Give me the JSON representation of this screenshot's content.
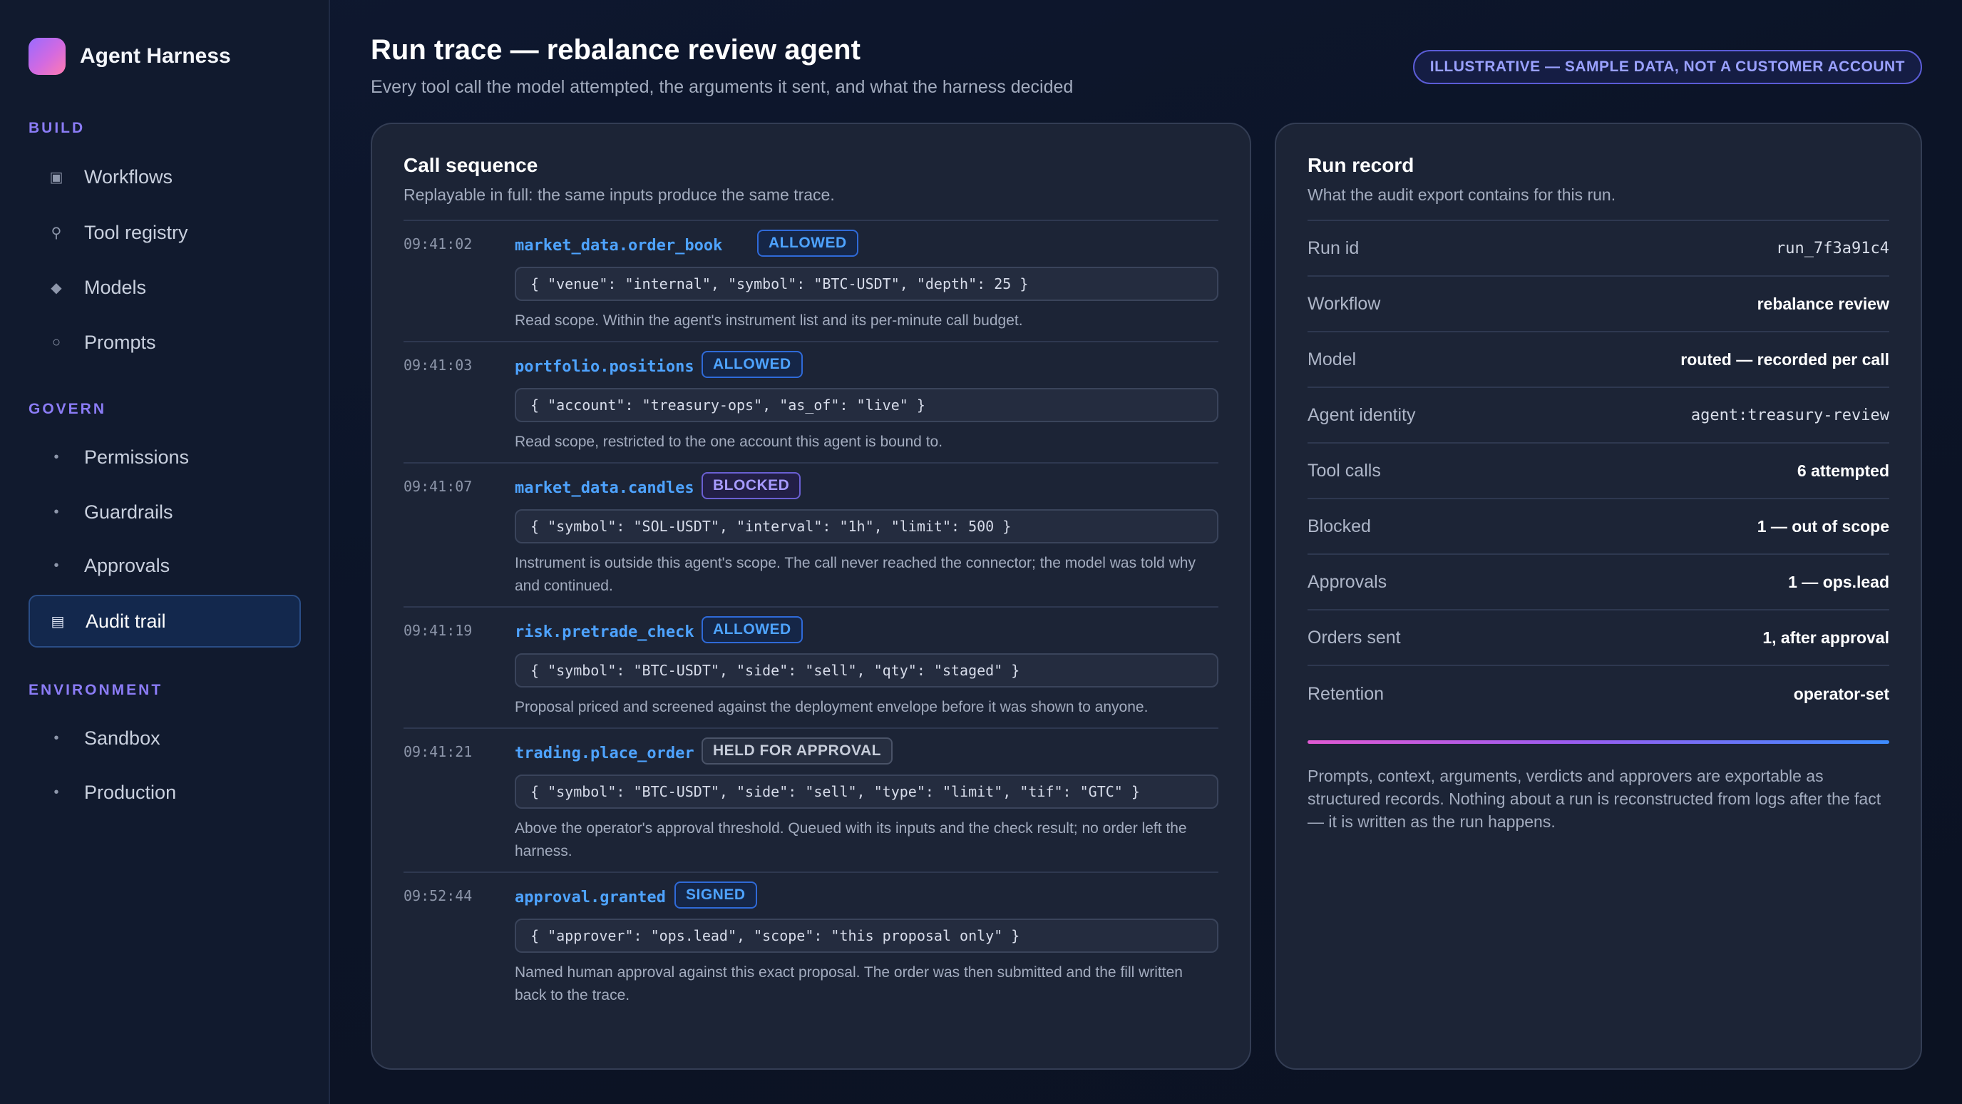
{
  "sidebar": {
    "brand": "Agent Harness",
    "sections": {
      "build": {
        "title": "BUILD",
        "items": [
          {
            "label": "Workflows",
            "icon": "square-dot-icon"
          },
          {
            "label": "Tool registry",
            "icon": "key-icon"
          },
          {
            "label": "Models",
            "icon": "diamond-icon"
          },
          {
            "label": "Prompts",
            "icon": "circle-icon"
          }
        ]
      },
      "govern": {
        "title": "GOVERN",
        "items": [
          {
            "label": "Permissions",
            "icon": "dot-icon"
          },
          {
            "label": "Guardrails",
            "icon": "dot-icon"
          },
          {
            "label": "Approvals",
            "icon": "dot-icon"
          },
          {
            "label": "Audit trail",
            "icon": "list-icon",
            "active": true
          }
        ]
      },
      "environment": {
        "title": "ENVIRONMENT",
        "items": [
          {
            "label": "Sandbox",
            "icon": "dot-icon"
          },
          {
            "label": "Production",
            "icon": "dot-icon"
          }
        ]
      }
    }
  },
  "header": {
    "title": "Run trace — rebalance review agent",
    "subtitle": "Every tool call the model attempted, the arguments it sent, and what the harness decided",
    "badge": "ILLUSTRATIVE — SAMPLE DATA, NOT A CUSTOMER ACCOUNT"
  },
  "calls_panel": {
    "title": "Call sequence",
    "subtitle": "Replayable in full: the same inputs produce the same trace.",
    "calls": [
      {
        "time": "09:41:02",
        "fn": "market_data.order_book",
        "verdict": "ALLOWED",
        "args": "{ \"venue\": \"internal\", \"symbol\": \"BTC-USDT\", \"depth\": 25 }",
        "note": "Read scope. Within the agent's instrument list and its per-minute call budget."
      },
      {
        "time": "09:41:03",
        "fn": "portfolio.positions",
        "verdict": "ALLOWED",
        "args": "{ \"account\": \"treasury-ops\", \"as_of\": \"live\" }",
        "note": "Read scope, restricted to the one account this agent is bound to."
      },
      {
        "time": "09:41:07",
        "fn": "market_data.candles",
        "verdict": "BLOCKED",
        "args": "{ \"symbol\": \"SOL-USDT\", \"interval\": \"1h\", \"limit\": 500 }",
        "note": "Instrument is outside this agent's scope. The call never reached the connector; the model was told why and continued."
      },
      {
        "time": "09:41:19",
        "fn": "risk.pretrade_check",
        "verdict": "ALLOWED",
        "args": "{ \"symbol\": \"BTC-USDT\", \"side\": \"sell\", \"qty\": \"staged\" }",
        "note": "Proposal priced and screened against the deployment envelope before it was shown to anyone."
      },
      {
        "time": "09:41:21",
        "fn": "trading.place_order",
        "verdict": "HELD FOR APPROVAL",
        "args": "{ \"symbol\": \"BTC-USDT\", \"side\": \"sell\", \"type\": \"limit\", \"tif\": \"GTC\" }",
        "note": "Above the operator's approval threshold. Queued with its inputs and the check result; no order left the harness."
      },
      {
        "time": "09:52:44",
        "fn": "approval.granted",
        "verdict": "SIGNED",
        "args": "{ \"approver\": \"ops.lead\", \"scope\": \"this proposal only\" }",
        "note": "Named human approval against this exact proposal. The order was then submitted and the fill written back to the trace."
      }
    ]
  },
  "run_record": {
    "title": "Run record",
    "subtitle": "What the audit export contains for this run.",
    "rows": [
      {
        "key": "Run id",
        "value": "run_7f3a91c4"
      },
      {
        "key": "Workflow",
        "value": "rebalance review"
      },
      {
        "key": "Model",
        "value": "routed — recorded per call"
      },
      {
        "key": "Agent identity",
        "value": "agent:treasury-review"
      },
      {
        "key": "Tool calls",
        "value": "6 attempted"
      },
      {
        "key": "Blocked",
        "value": "1 — out of scope"
      },
      {
        "key": "Approvals",
        "value": "1 — ops.lead"
      },
      {
        "key": "Orders sent",
        "value": "1, after approval"
      },
      {
        "key": "Retention",
        "value": "operator-set"
      }
    ],
    "footer": "Prompts, context, arguments, verdicts and approvers are exportable as structured records. Nothing about a run is reconstructed from logs after the fact — it is written as the run happens."
  }
}
